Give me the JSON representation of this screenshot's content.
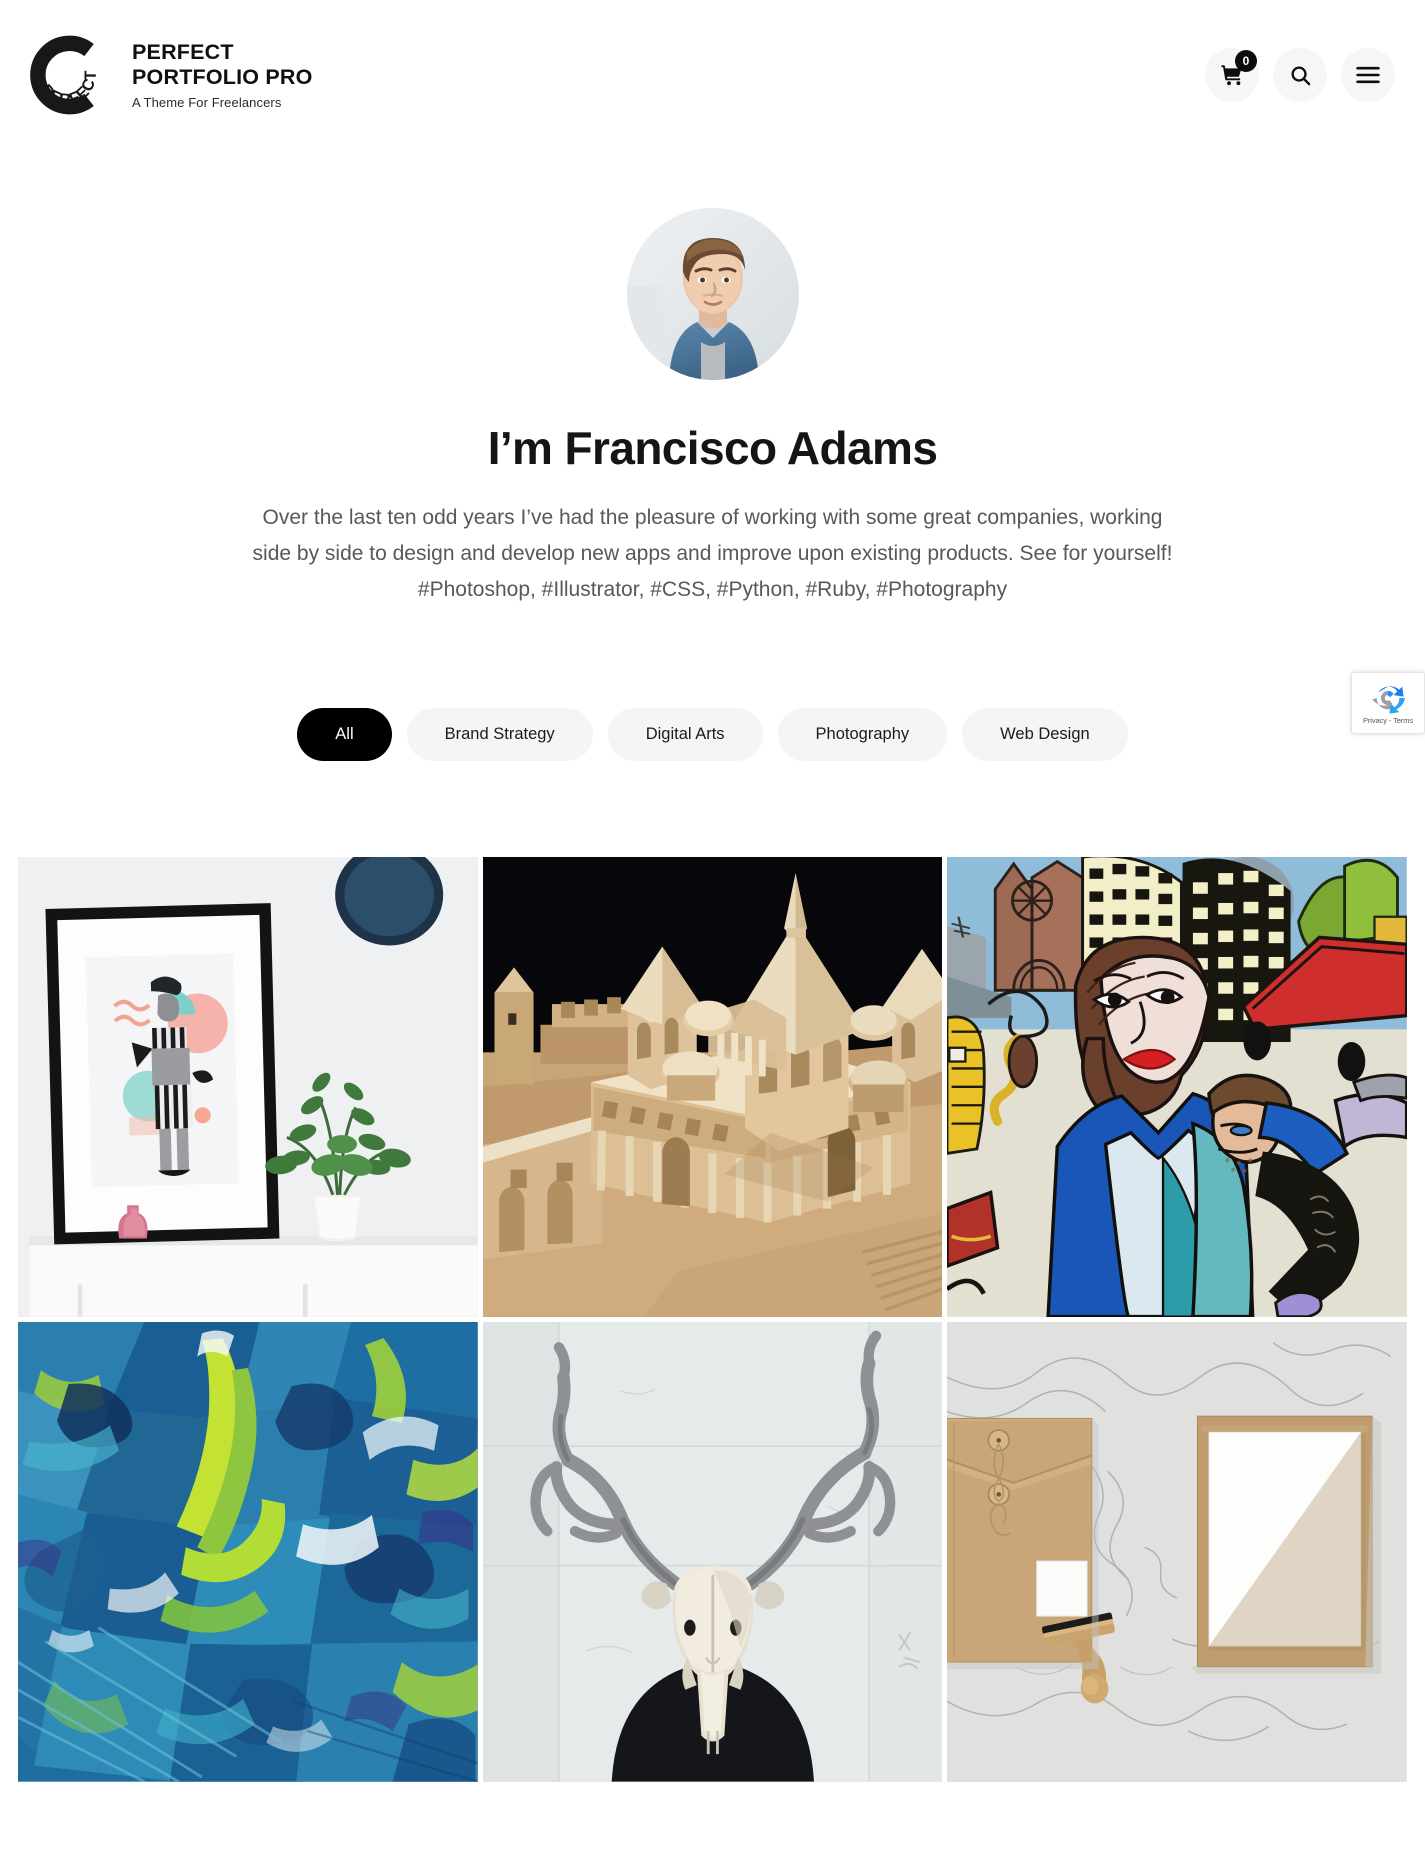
{
  "header": {
    "logo": {
      "icon": "circular-c-logo",
      "ring_text": "PERFECT"
    },
    "brand_title": "PERFECT PORTFOLIO PRO",
    "brand_tagline": "A Theme For Freelancers",
    "actions": {
      "cart": {
        "icon": "shopping-cart-icon",
        "badge_count": "0"
      },
      "search": {
        "icon": "search-icon"
      },
      "menu": {
        "icon": "hamburger-menu-icon"
      }
    }
  },
  "hero": {
    "avatar_alt": "Portrait photo of a man in a denim jacket",
    "title": "I’m Francisco Adams",
    "title_highlight_color": "#e7f4ee",
    "description_line1": "Over the last ten odd years I’ve had the pleasure of working with some great companies, working",
    "description_line2": "side by side to design and develop new apps and improve upon existing products. See for yourself!",
    "description_line3": "#Photoshop, #Illustrator, #CSS, #Python, #Ruby, #Photography"
  },
  "filters": [
    {
      "label": "All",
      "active": true
    },
    {
      "label": "Brand Strategy",
      "active": false
    },
    {
      "label": "Digital Arts",
      "active": false
    },
    {
      "label": "Photography",
      "active": false
    },
    {
      "label": "Web Design",
      "active": false
    }
  ],
  "portfolio": [
    {
      "alt": "Framed pastel collage art print on white shelf with potted plant and pink vase"
    },
    {
      "alt": "Cardboard architectural scale model of a domed civic building"
    },
    {
      "alt": "Naive-style colorful painting of a woman in a city street scene"
    },
    {
      "alt": "Abstract blue and green impasto palette-knife painting"
    },
    {
      "alt": "Deer skull with antlers held against a white wall"
    },
    {
      "alt": "Kraft envelope, rubber stamp and blank paper branding mockup on marble"
    }
  ],
  "recaptcha": {
    "icon": "recaptcha-icon",
    "text": "Privacy - Terms"
  }
}
